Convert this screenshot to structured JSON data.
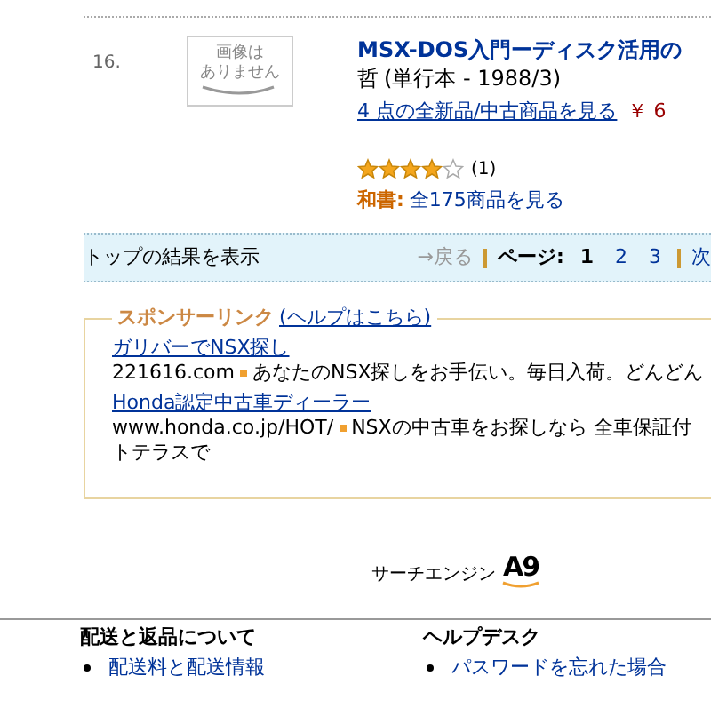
{
  "result": {
    "number": "16.",
    "image_text": [
      "画像は",
      "ありません"
    ],
    "title": "MSX-DOS入門ーディスク活用の",
    "author": "哲",
    "format": "(単行本 - 1988/3)",
    "offers_link": "4 点の全新品/中古商品を見る",
    "price": "￥ 6",
    "stars": 4,
    "review_count": "(1)",
    "category_label": "和書:",
    "category_link": "全175商品を見る"
  },
  "pagination": {
    "summary": "トップの結果を表示",
    "prev": "→戻る",
    "page_label": "ページ:",
    "pages": [
      {
        "label": "1",
        "selected": true
      },
      {
        "label": "2",
        "selected": false
      },
      {
        "label": "3",
        "selected": false
      }
    ],
    "next": "次"
  },
  "sponsored": {
    "title": "スポンサーリンク",
    "help_link": "(ヘルプはこちら)",
    "ads": [
      {
        "title": "ガリバーでNSX探し",
        "url": "221616.com",
        "text": "あなたのNSX探しをお手伝い。毎日入荷。どんどん"
      },
      {
        "title": "Honda認定中古車ディーラー",
        "url": "www.honda.co.jp/HOT/",
        "text": "NSXの中古車をお探しなら 全車保証付",
        "text_continued": "トテラスで"
      }
    ]
  },
  "search_engine": {
    "label": "サーチエンジン",
    "logo": "A9"
  },
  "footer": {
    "columns": [
      {
        "heading": "配送と返品について",
        "links": [
          "配送料と配送情報"
        ]
      },
      {
        "heading": "ヘルプデスク",
        "links": [
          "パスワードを忘れた場合"
        ]
      }
    ]
  }
}
